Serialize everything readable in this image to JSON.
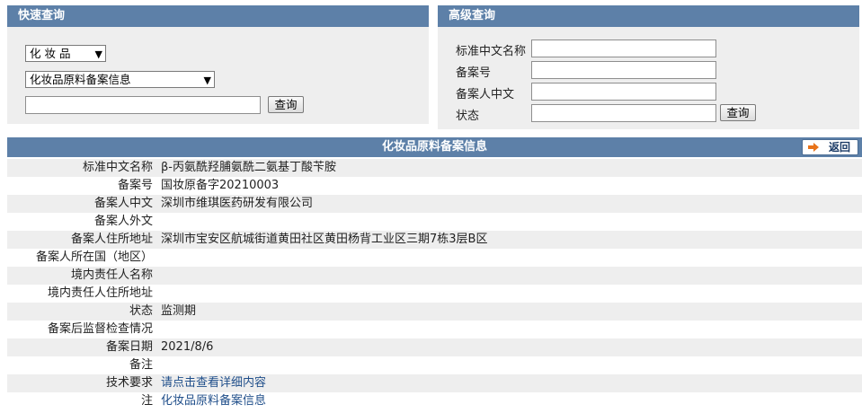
{
  "quick_search": {
    "title": "快速查询",
    "category_select": "化 妆 品",
    "type_select": "化妆品原料备案信息",
    "keyword_value": "",
    "search_button": "查询"
  },
  "advanced_search": {
    "title": "高级查询",
    "fields": [
      {
        "label": "标准中文名称",
        "value": ""
      },
      {
        "label": "备案号",
        "value": ""
      },
      {
        "label": "备案人中文",
        "value": ""
      },
      {
        "label": "状态",
        "value": ""
      }
    ],
    "search_button": "查询"
  },
  "detail": {
    "title": "化妆品原料备案信息",
    "back_button": "返回",
    "rows": [
      {
        "label": "标准中文名称",
        "value": "β-丙氨酰羟脯氨酰二氨基丁酸苄胺"
      },
      {
        "label": "备案号",
        "value": "国妆原备字20210003"
      },
      {
        "label": "备案人中文",
        "value": "深圳市维琪医药研发有限公司"
      },
      {
        "label": "备案人外文",
        "value": ""
      },
      {
        "label": "备案人住所地址",
        "value": "深圳市宝安区航城街道黄田社区黄田杨背工业区三期7栋3层B区"
      },
      {
        "label": "备案人所在国（地区）",
        "value": ""
      },
      {
        "label": "境内责任人名称",
        "value": ""
      },
      {
        "label": "境内责任人住所地址",
        "value": ""
      },
      {
        "label": "状态",
        "value": "监测期"
      },
      {
        "label": "备案后监督检查情况",
        "value": ""
      },
      {
        "label": "备案日期",
        "value": "2021/8/6"
      },
      {
        "label": "备注",
        "value": ""
      },
      {
        "label": "技术要求",
        "value": "请点击查看详细内容"
      },
      {
        "label": "注",
        "value": "化妆品原料备案信息"
      }
    ]
  },
  "colors": {
    "header_bg": "#5d80a8",
    "panel_bg": "#eeeeee",
    "link": "#1f4e8a",
    "back_arrow": "#e8731a"
  }
}
